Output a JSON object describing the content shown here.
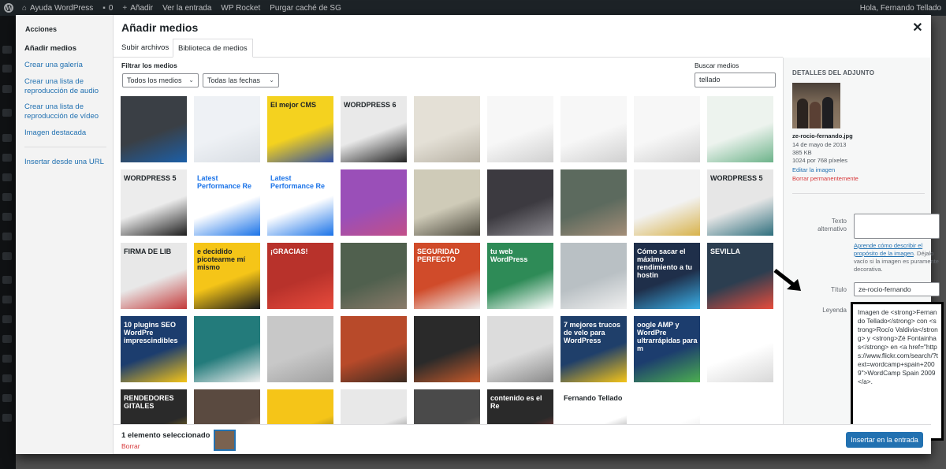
{
  "admin_bar": {
    "site_name": "Ayuda WordPress",
    "comments_count": "0",
    "new_label": "Añadir",
    "view_entry": "Ver la entrada",
    "rocket": "WP Rocket",
    "purge": "Purgar caché de SG",
    "greeting": "Hola, Fernando Tellado"
  },
  "modal": {
    "title": "Añadir medios",
    "close_icon": "close-icon",
    "sidebar": {
      "heading": "Acciones",
      "items": [
        {
          "label": "Añadir medios",
          "active": true
        },
        {
          "label": "Crear una galería",
          "active": false
        },
        {
          "label": "Crear una lista de reproducción de audio",
          "active": false
        },
        {
          "label": "Crear una lista de reproducción de vídeo",
          "active": false
        },
        {
          "label": "Imagen destacada",
          "active": false
        },
        {
          "label": "Insertar desde una URL",
          "active": false
        }
      ]
    },
    "tabs": [
      {
        "label": "Subir archivos",
        "active": false
      },
      {
        "label": "Biblioteca de medios",
        "active": true
      }
    ],
    "filters": {
      "label": "Filtrar los medios",
      "type_select": "Todos los medios",
      "date_select": "Todas las fechas",
      "search_label": "Buscar medios",
      "search_value": "tellado"
    },
    "grid": {
      "tiles": [
        {
          "bg": "#3a3f45",
          "accent": "#1c5fa8",
          "text": ""
        },
        {
          "bg": "#eef1f5",
          "accent": "#d8dde3",
          "text": ""
        },
        {
          "bg": "#f4d21f",
          "accent": "#2d4da6",
          "text": "El mejor CMS"
        },
        {
          "bg": "#e9e9e9",
          "accent": "#222222",
          "text": "WORDPRESS 6"
        },
        {
          "bg": "#e4e0d6",
          "accent": "#b7b1a4",
          "text": ""
        },
        {
          "bg": "#f7f7f7",
          "accent": "#d0d0d0",
          "text": ""
        },
        {
          "bg": "#f7f7f7",
          "accent": "#d0d0d0",
          "text": ""
        },
        {
          "bg": "#f7f7f7",
          "accent": "#d0d0d0",
          "text": ""
        },
        {
          "bg": "#edf3ee",
          "accent": "#6db38a",
          "text": ""
        },
        {
          "bg": "#ececec",
          "accent": "#1d1d1d",
          "text": "WORDPRESS 5"
        },
        {
          "bg": "#ffffff",
          "accent": "#1a73e8",
          "text": "Latest Performance Re"
        },
        {
          "bg": "#ffffff",
          "accent": "#1a73e8",
          "text": "Latest Performance Re"
        },
        {
          "bg": "#9a4fb8",
          "accent": "#c24f88",
          "text": ""
        },
        {
          "bg": "#cfcbb8",
          "accent": "#4d4a3e",
          "text": ""
        },
        {
          "bg": "#3c3a40",
          "accent": "#8c8a90",
          "text": ""
        },
        {
          "bg": "#5c6a5e",
          "accent": "#a48e78",
          "text": ""
        },
        {
          "bg": "#f2f2f2",
          "accent": "#d8b24a",
          "text": ""
        },
        {
          "bg": "#e6e6e6",
          "accent": "#2f6f7d",
          "text": "WORDPRESS 5"
        },
        {
          "bg": "#e8e8e8",
          "accent": "#c43a3a",
          "text": "FIRMA DE LIB"
        },
        {
          "bg": "#f5c518",
          "accent": "#1a1a1a",
          "text": "e decidido picotearme mí mismo"
        },
        {
          "bg": "#b8322b",
          "accent": "#e84b3c",
          "text": "¡GRACIAS!"
        },
        {
          "bg": "#50604e",
          "accent": "#8a7b6a",
          "text": ""
        },
        {
          "bg": "#d04b2a",
          "accent": "#f0f0f0",
          "text": "SEGURIDAD PERFECTO"
        },
        {
          "bg": "#2e8b57",
          "accent": "#ffffff",
          "text": "tu web WordPress"
        },
        {
          "bg": "#b9c0c4",
          "accent": "#f0f0f0",
          "text": ""
        },
        {
          "bg": "#1f2f4a",
          "accent": "#3ab0e8",
          "text": "Cómo sacar el máximo rendimiento a tu hostin"
        },
        {
          "bg": "#2c3e50",
          "accent": "#e74c3c",
          "text": "SEVILLA"
        },
        {
          "bg": "#1c3d6e",
          "accent": "#f5c518",
          "text": "10 plugins SEO WordPre imprescindibles"
        },
        {
          "bg": "#237b7b",
          "accent": "#f0f0f0",
          "text": ""
        },
        {
          "bg": "#c8c8c8",
          "accent": "#a0a0a0",
          "text": ""
        },
        {
          "bg": "#b84a2a",
          "accent": "#3a2a20",
          "text": ""
        },
        {
          "bg": "#2a2a2a",
          "accent": "#c85a2a",
          "text": ""
        },
        {
          "bg": "#dcdcdc",
          "accent": "#8a8a8a",
          "text": ""
        },
        {
          "bg": "#1f3f6a",
          "accent": "#f5c518",
          "text": "7 mejores trucos de velo para WordPress"
        },
        {
          "bg": "#1c3d6e",
          "accent": "#4caf50",
          "text": "oogle AMP y WordPre ultrarrápidas para m"
        },
        {
          "bg": "#ffffff",
          "accent": "#d8d8d8",
          "text": ""
        },
        {
          "bg": "#2a2a2a",
          "accent": "#f5c518",
          "text": "RENDEDORES GITALES"
        },
        {
          "bg": "#5a4a40",
          "accent": "#c8a080",
          "text": ""
        },
        {
          "bg": "#f5c518",
          "accent": "#2a2a2a",
          "text": ""
        },
        {
          "bg": "#e8e8e8",
          "accent": "#2a2a2a",
          "text": ""
        },
        {
          "bg": "#4a4a4a",
          "accent": "#b0a090",
          "text": ""
        },
        {
          "bg": "#2a2a2a",
          "accent": "#e84b3c",
          "text": "contenido es el Re"
        },
        {
          "bg": "#ffffff",
          "accent": "#333333",
          "text": "Fernando Tellado"
        },
        {
          "bg": "#ffffff",
          "accent": "#cfcfcf",
          "text": ""
        }
      ]
    },
    "details": {
      "heading": "DETALLES DEL ADJUNTO",
      "filename": "ze-rocio-fernando.jpg",
      "date": "14 de mayo de 2013",
      "size": "385 KB",
      "dimensions": "1024 por 768 píxeles",
      "edit_link": "Editar la imagen",
      "delete_link": "Borrar permanentemente",
      "alt_label": "Texto alternativo",
      "alt_help_link": "Aprende cómo describir el propósito de la imagen",
      "alt_help_rest": ". Déjalo vacío si la imagen es puramente decorativa.",
      "title_label": "Título",
      "title_value": "ze-rocio-fernando",
      "caption_label": "Leyenda",
      "caption_value": "Imagen de <strong>Fernando Tellado</strong> con <strong>Rocío Valdivia</strong> y <strong>Zé Fontainhas</strong> en <a href=\"https://www.flickr.com/search/?text=wordcamp+spain+2009\">WordCamp Spain 2009</a>."
    },
    "toolbar": {
      "selected_text": "1 elemento seleccionado",
      "clear_label": "Borrar",
      "insert_label": "Insertar en la entrada"
    }
  }
}
